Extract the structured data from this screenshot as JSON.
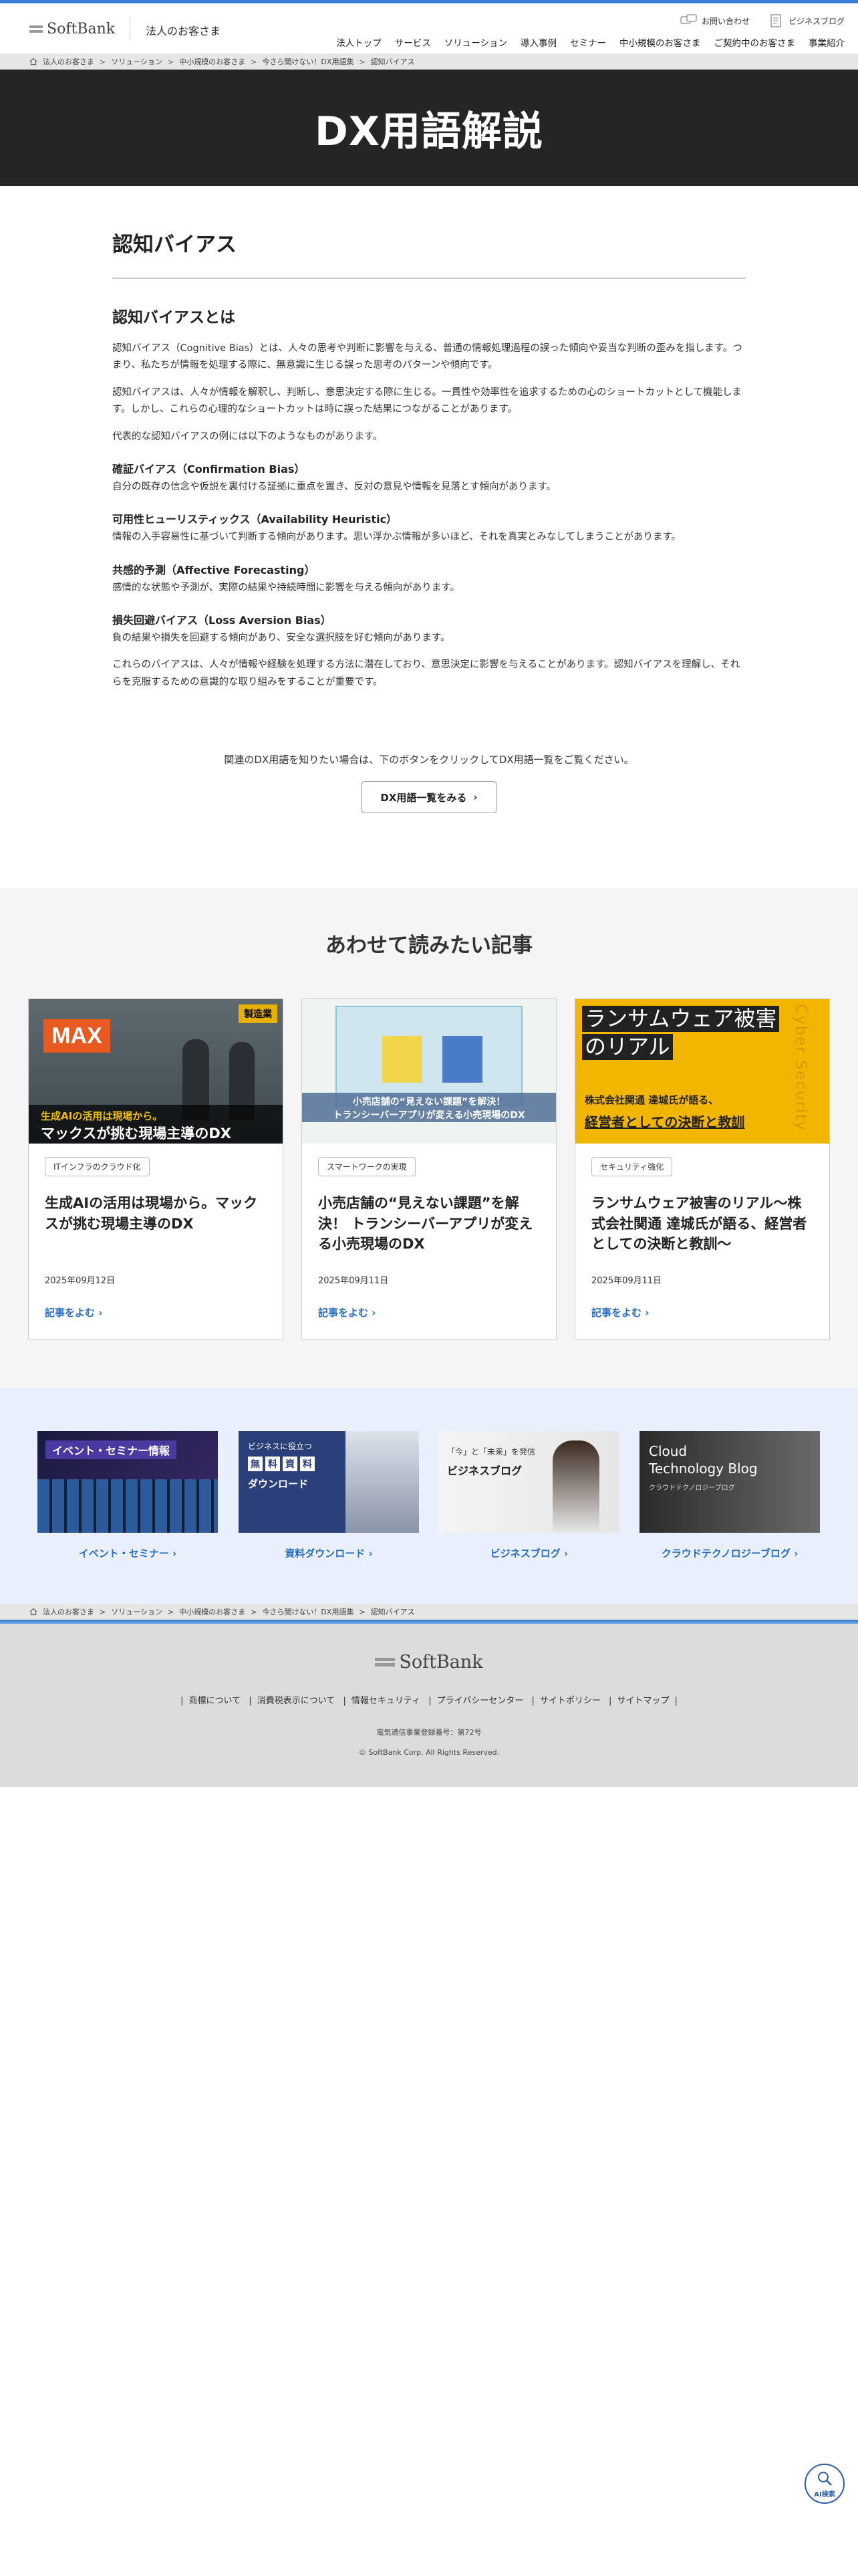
{
  "header": {
    "logo_text": "SoftBank",
    "section": "法人のお客さま",
    "util": [
      "お問い合わせ",
      "ビジネスブログ"
    ],
    "nav": [
      "法人トップ",
      "サービス",
      "ソリューション",
      "導入事例",
      "セミナー",
      "中小規模のお客さま",
      "ご契約中のお客さま",
      "事業紹介"
    ]
  },
  "breadcrumb": [
    "法人のお客さま",
    "ソリューション",
    "中小規模のお客さま",
    "今さら聞けない！DX用語集",
    "認知バイアス"
  ],
  "hero": {
    "title": "DX用語解説"
  },
  "article": {
    "title": "認知バイアス",
    "heading": "認知バイアスとは",
    "p1": "認知バイアス（Cognitive Bias）とは、人々の思考や判断に影響を与える、普通の情報処理過程の誤った傾向や妥当な判断の歪みを指します。つまり、私たちが情報を処理する際に、無意識に生じる誤った思考のパターンや傾向です。",
    "p2": "認知バイアスは、人々が情報を解釈し、判断し、意思決定する際に生じる。一貫性や効率性を追求するための心のショートカットとして機能します。しかし、これらの心理的なショートカットは時に誤った結果につながることがあります。",
    "p3": "代表的な認知バイアスの例には以下のようなものがあります。",
    "items": [
      {
        "title": "確証バイアス（Confirmation Bias）",
        "text": "自分の既存の信念や仮説を裏付ける証拠に重点を置き、反対の意見や情報を見落とす傾向があります。"
      },
      {
        "title": "可用性ヒューリスティックス（Availability Heuristic）",
        "text": "情報の入手容易性に基づいて判断する傾向があります。思い浮かぶ情報が多いほど、それを真実とみなしてしまうことがあります。"
      },
      {
        "title": "共感的予測（Affective Forecasting）",
        "text": "感情的な状態や予測が、実際の結果や持続時間に影響を与える傾向があります。"
      },
      {
        "title": "損失回避バイアス（Loss Aversion Bias）",
        "text": "負の結果や損失を回避する傾向があり、安全な選択肢を好む傾向があります。"
      }
    ],
    "p4": "これらのバイアスは、人々が情報や経験を処理する方法に潜在しており、意思決定に影響を与えることがあります。認知バイアスを理解し、それらを克服するための意識的な取り組みをすることが重要です。",
    "cta_text": "関連のDX用語を知りたい場合は、下のボタンをクリックしてDX用語一覧をご覧ください。",
    "cta_button": "DX用語一覧をみる"
  },
  "related": {
    "title": "あわせて読みたい記事",
    "cards": [
      {
        "tag": "ITインフラのクラウド化",
        "title": "生成AIの活用は現場から。マックスが挑む現場主導のDX",
        "date": "2025年09月12日",
        "more": "記事をよむ",
        "img_badge": "製造業",
        "img_logo": "MAX",
        "img_line1": "生成AIの活用は現場から。",
        "img_line2": "マックスが挑む現場主導のDX"
      },
      {
        "tag": "スマートワークの実現",
        "title": "小売店舗の“見えない課題”を解決！ トランシーバーアプリが変える小売現場のDX",
        "date": "2025年09月11日",
        "more": "記事をよむ",
        "img_line1": "小売店舗の“見えない課題”を解決！",
        "img_line2": "トランシーバーアプリが変える小売現場のDX"
      },
      {
        "tag": "セキュリティ強化",
        "title": "ランサムウェア被害のリアル〜株式会社関通 達城氏が語る、経営者としての決断と教訓〜",
        "date": "2025年09月11日",
        "more": "記事をよむ",
        "img_line1": "ランサムウェア被害",
        "img_line2": "のリアル",
        "img_line3": "株式会社関通 達城氏が語る、",
        "img_line4": "経営者としての決断と教訓",
        "img_side": "Cyber Security"
      }
    ]
  },
  "banners": [
    {
      "label": "イベント・セミナー",
      "img_text": "イベント・セミナー情報"
    },
    {
      "label": "資料ダウンロード",
      "img_line1": "ビジネスに役立つ",
      "img_chars": [
        "無",
        "料",
        "資",
        "料"
      ],
      "img_line3": "ダウンロード"
    },
    {
      "label": "ビジネスブログ",
      "img_line1": "「今」と「未来」を発信",
      "img_line2": "ビジネスブログ"
    },
    {
      "label": "クラウドテクノロジーブログ",
      "img_line1": "Cloud",
      "img_line2": "Technology Blog",
      "img_line3": "クラウドテクノロジーブログ"
    }
  ],
  "footer": {
    "logo_text": "SoftBank",
    "links": [
      "商標について",
      "消費税表示について",
      "情報セキュリティ",
      "プライバシーセンター",
      "サイトポリシー",
      "サイトマップ"
    ],
    "reg": "電気通信事業登録番号：第72号",
    "copy": "© SoftBank Corp. All Rights Reserved."
  },
  "ai_button": "AI検索",
  "colors": {
    "accent": "#3a7bd5",
    "link": "#2a6fc6",
    "hero_bg": "#252525"
  }
}
